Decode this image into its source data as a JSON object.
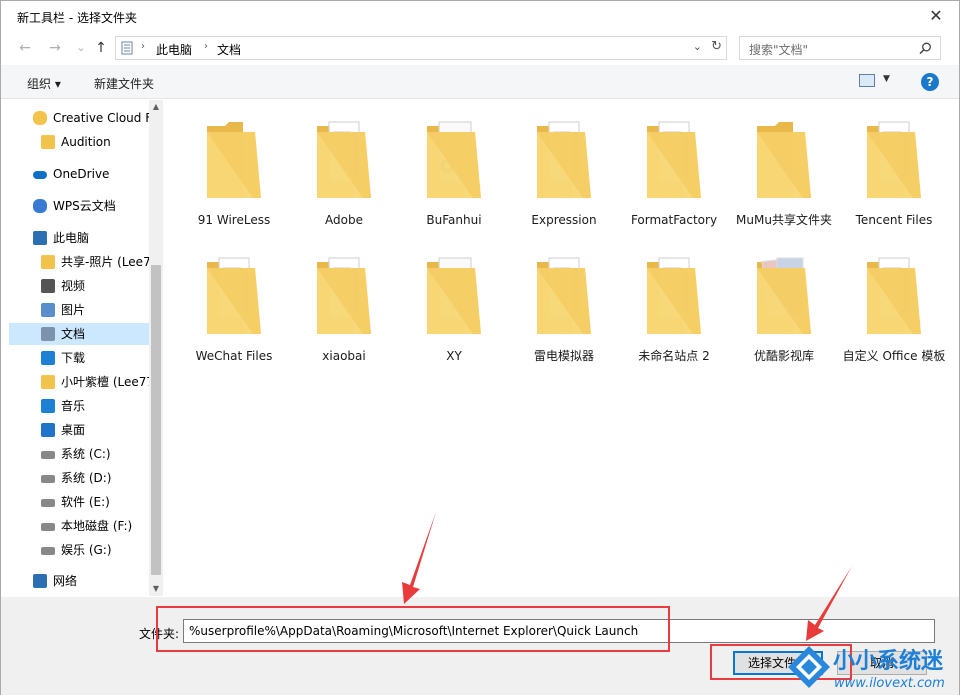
{
  "window": {
    "title": "新工具栏 - 选择文件夹",
    "close_glyph": "✕"
  },
  "nav": {
    "back_glyph": "←",
    "forward_glyph": "→",
    "dropdown_glyph": "⌄",
    "up_glyph": "↑",
    "breadcrumb": [
      "此电脑",
      "文档"
    ],
    "search_placeholder": "搜索\"文档\""
  },
  "toolbar": {
    "organize_label": "组织 ▾",
    "new_folder_label": "新建文件夹",
    "help_label": "?"
  },
  "sidebar": {
    "items": [
      {
        "label": "Creative Cloud F",
        "icon": "creative-cloud-icon"
      },
      {
        "label": "Audition",
        "icon": "folder-icon"
      },
      {
        "label": "OneDrive",
        "icon": "onedrive-icon"
      },
      {
        "label": "WPS云文档",
        "icon": "wps-cloud-icon"
      },
      {
        "label": "此电脑",
        "icon": "computer-icon"
      },
      {
        "label": "共享-照片 (Lee7",
        "icon": "shared-folder-icon"
      },
      {
        "label": "视频",
        "icon": "video-icon"
      },
      {
        "label": "图片",
        "icon": "pictures-icon"
      },
      {
        "label": "文档",
        "icon": "documents-icon"
      },
      {
        "label": "下载",
        "icon": "download-icon"
      },
      {
        "label": "小叶紫檀 (Lee77",
        "icon": "shared-folder-icon"
      },
      {
        "label": "音乐",
        "icon": "music-icon"
      },
      {
        "label": "桌面",
        "icon": "desktop-icon"
      },
      {
        "label": "系统 (C:)",
        "icon": "system-drive-icon"
      },
      {
        "label": "系统 (D:)",
        "icon": "drive-icon"
      },
      {
        "label": "软件 (E:)",
        "icon": "drive-icon"
      },
      {
        "label": "本地磁盘 (F:)",
        "icon": "drive-icon"
      },
      {
        "label": "娱乐 (G:)",
        "icon": "drive-icon"
      },
      {
        "label": "网络",
        "icon": "network-icon"
      }
    ]
  },
  "files": [
    {
      "label": "91 WireLess",
      "type": "folder"
    },
    {
      "label": "Adobe",
      "type": "folder-docs"
    },
    {
      "label": "BuFanhui",
      "type": "folder-gear"
    },
    {
      "label": "Expression",
      "type": "folder-docs"
    },
    {
      "label": "FormatFactory",
      "type": "folder-docs"
    },
    {
      "label": "MuMu共享文件夹",
      "type": "folder"
    },
    {
      "label": "Tencent Files",
      "type": "folder-docs"
    },
    {
      "label": "WeChat Files",
      "type": "folder-docs"
    },
    {
      "label": "xiaobai",
      "type": "folder-docs"
    },
    {
      "label": "XY",
      "type": "folder-white"
    },
    {
      "label": "雷电模拟器",
      "type": "folder-docs"
    },
    {
      "label": "未命名站点 2",
      "type": "folder-docs"
    },
    {
      "label": "优酷影视库",
      "type": "folder-photo"
    },
    {
      "label": "自定义 Office 模板",
      "type": "folder-docs"
    }
  ],
  "bottom": {
    "folder_label": "文件夹:",
    "folder_value": "%userprofile%\\AppData\\Roaming\\Microsoft\\Internet Explorer\\Quick Launch",
    "select_button": "选择文件夹",
    "cancel_button": "取消"
  },
  "watermark": {
    "text": "小小系统迷",
    "url": "www.ilovext.com"
  },
  "colors": {
    "accent": "#0078d7",
    "selection": "#cce8ff",
    "annotation_red": "#ea3c3c",
    "folder_yellow": "#f8d775"
  }
}
